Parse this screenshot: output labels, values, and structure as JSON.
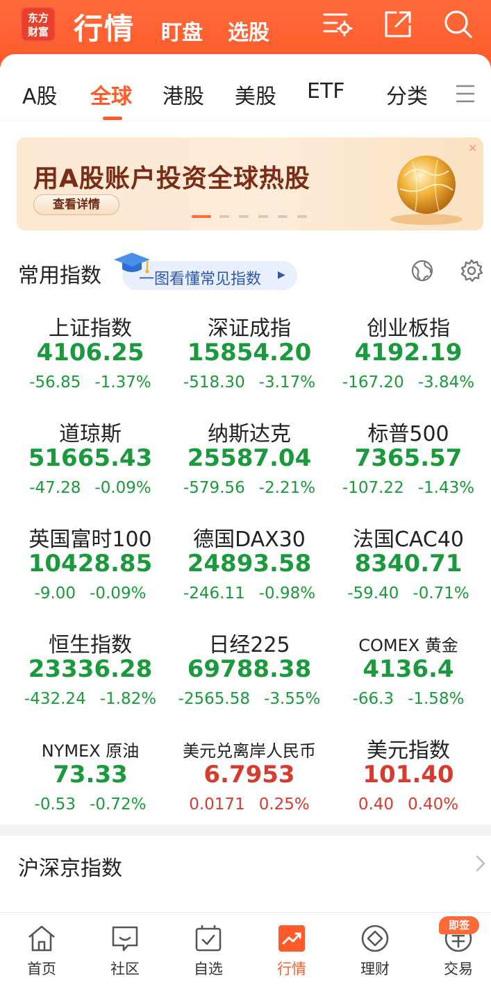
{
  "header": {
    "logo_line1": "东方",
    "logo_line2": "财富",
    "title": "行情",
    "tabs": [
      "盯盘",
      "选股"
    ],
    "icons": [
      "settings-filter-icon",
      "share-icon",
      "search-icon"
    ]
  },
  "market_tabs": {
    "items": [
      "A股",
      "全球",
      "港股",
      "美股",
      "ETF",
      "分类"
    ],
    "active": "全球"
  },
  "banner": {
    "title": "用A股账户投资全球热股",
    "button": "查看详情",
    "slide_count": 6,
    "active_slide": 1
  },
  "common_indices": {
    "title": "常用指数",
    "guide": "一图看懂常见指数",
    "items": [
      {
        "name": "上证指数",
        "price": "4106.25",
        "change": "-56.85",
        "pct": "-1.37%",
        "trend": "down"
      },
      {
        "name": "深证成指",
        "price": "15854.20",
        "change": "-518.30",
        "pct": "-3.17%",
        "trend": "down"
      },
      {
        "name": "创业板指",
        "price": "4192.19",
        "change": "-167.20",
        "pct": "-3.84%",
        "trend": "down"
      },
      {
        "name": "道琼斯",
        "price": "51665.43",
        "change": "-47.28",
        "pct": "-0.09%",
        "trend": "down"
      },
      {
        "name": "纳斯达克",
        "price": "25587.04",
        "change": "-579.56",
        "pct": "-2.21%",
        "trend": "down"
      },
      {
        "name": "标普500",
        "price": "7365.57",
        "change": "-107.22",
        "pct": "-1.43%",
        "trend": "down"
      },
      {
        "name": "英国富时100",
        "price": "10428.85",
        "change": "-9.00",
        "pct": "-0.09%",
        "trend": "down"
      },
      {
        "name": "德国DAX30",
        "price": "24893.58",
        "change": "-246.11",
        "pct": "-0.98%",
        "trend": "down"
      },
      {
        "name": "法国CAC40",
        "price": "8340.71",
        "change": "-59.40",
        "pct": "-0.71%",
        "trend": "down"
      },
      {
        "name": "恒生指数",
        "price": "23336.28",
        "change": "-432.24",
        "pct": "-1.82%",
        "trend": "down"
      },
      {
        "name": "日经225",
        "price": "69788.38",
        "change": "-2565.58",
        "pct": "-3.55%",
        "trend": "down"
      },
      {
        "name": "COMEX 黄金",
        "price": "4136.4",
        "change": "-66.3",
        "pct": "-1.58%",
        "trend": "down"
      },
      {
        "name": "NYMEX 原油",
        "price": "73.33",
        "change": "-0.53",
        "pct": "-0.72%",
        "trend": "down"
      },
      {
        "name": "美元兑离岸人民币",
        "price": "6.7953",
        "change": "0.0171",
        "pct": "0.25%",
        "trend": "up"
      },
      {
        "name": "美元指数",
        "price": "101.40",
        "change": "0.40",
        "pct": "0.40%",
        "trend": "up"
      }
    ]
  },
  "hs_section": {
    "title": "沪深京指数"
  },
  "bottom_nav": {
    "items": [
      {
        "label": "首页",
        "icon": "home-icon"
      },
      {
        "label": "社区",
        "icon": "community-icon"
      },
      {
        "label": "自选",
        "icon": "watchlist-icon"
      },
      {
        "label": "行情",
        "icon": "market-icon"
      },
      {
        "label": "理财",
        "icon": "wealth-icon"
      },
      {
        "label": "交易",
        "icon": "trade-icon"
      }
    ],
    "active": "行情",
    "badge": "即签"
  },
  "colors": {
    "brand": "#ff5a2a",
    "down": "#1a9a3c",
    "up": "#d93a2f"
  }
}
